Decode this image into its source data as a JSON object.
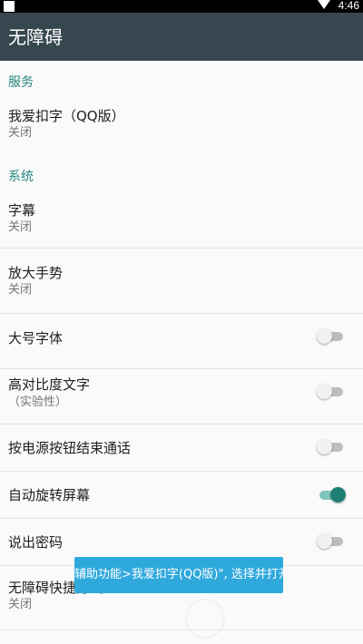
{
  "status_bar": {
    "time": "4:46"
  },
  "app_bar": {
    "title": "无障碍"
  },
  "sections": {
    "services": {
      "header": "服务"
    },
    "system": {
      "header": "系统"
    }
  },
  "items": {
    "woaikouzi": {
      "title": "我爱扣字（QQ版）",
      "summary": "关闭"
    },
    "captions": {
      "title": "字幕",
      "summary": "关闭"
    },
    "magnification": {
      "title": "放大手势",
      "summary": "关闭"
    },
    "large_text": {
      "title": "大号字体",
      "enabled": false
    },
    "high_contrast": {
      "title": "高对比度文字",
      "summary": "（实验性）",
      "enabled": false
    },
    "power_ends_call": {
      "title": "按电源按钮结束通话",
      "enabled": false
    },
    "auto_rotate": {
      "title": "自动旋转屏幕",
      "enabled": true
    },
    "speak_passwords": {
      "title": "说出密码",
      "enabled": false
    },
    "shortcut": {
      "title": "无障碍快捷方式",
      "summary": "关闭"
    }
  },
  "toast": {
    "text": "辅助功能>我爱扣字(QQ版)\", 选择并打开!"
  },
  "colors": {
    "app_bar": "#37474f",
    "accent": "#26867e",
    "toast": "#2fa8dc"
  },
  "icons": {
    "status_left": "notification-icon",
    "status_signal": "wifi-icon"
  }
}
